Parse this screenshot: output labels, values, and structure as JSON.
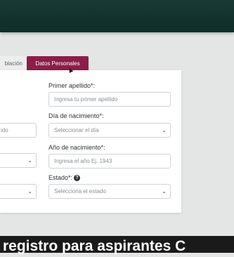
{
  "tabs": {
    "prev_label": "blación",
    "active_label": "Datos Personales"
  },
  "form": {
    "primer_apellido": {
      "label": "Primer apellido*:",
      "placeholder": "Ingresa tu primer apellido"
    },
    "dia_nacimiento": {
      "label": "Día de nacimiento*:",
      "value": "Seleccionar el día"
    },
    "anio_nacimiento": {
      "label": "Año de nacimiento*:",
      "placeholder": "Ingresa el año Ej. 1943"
    },
    "estado": {
      "label": "Estado*:",
      "value": "Selecciona el estado"
    },
    "left_field_text": "ido"
  },
  "banner": {
    "text": "registro para aspirantes C"
  },
  "colors": {
    "tab_active": "#8c1d49",
    "topbar": "#0f2c28"
  },
  "icons": {
    "help": "question-circle-icon",
    "dropdown": "chevron-down-icon",
    "cursor": "mouse-pointer-icon"
  }
}
